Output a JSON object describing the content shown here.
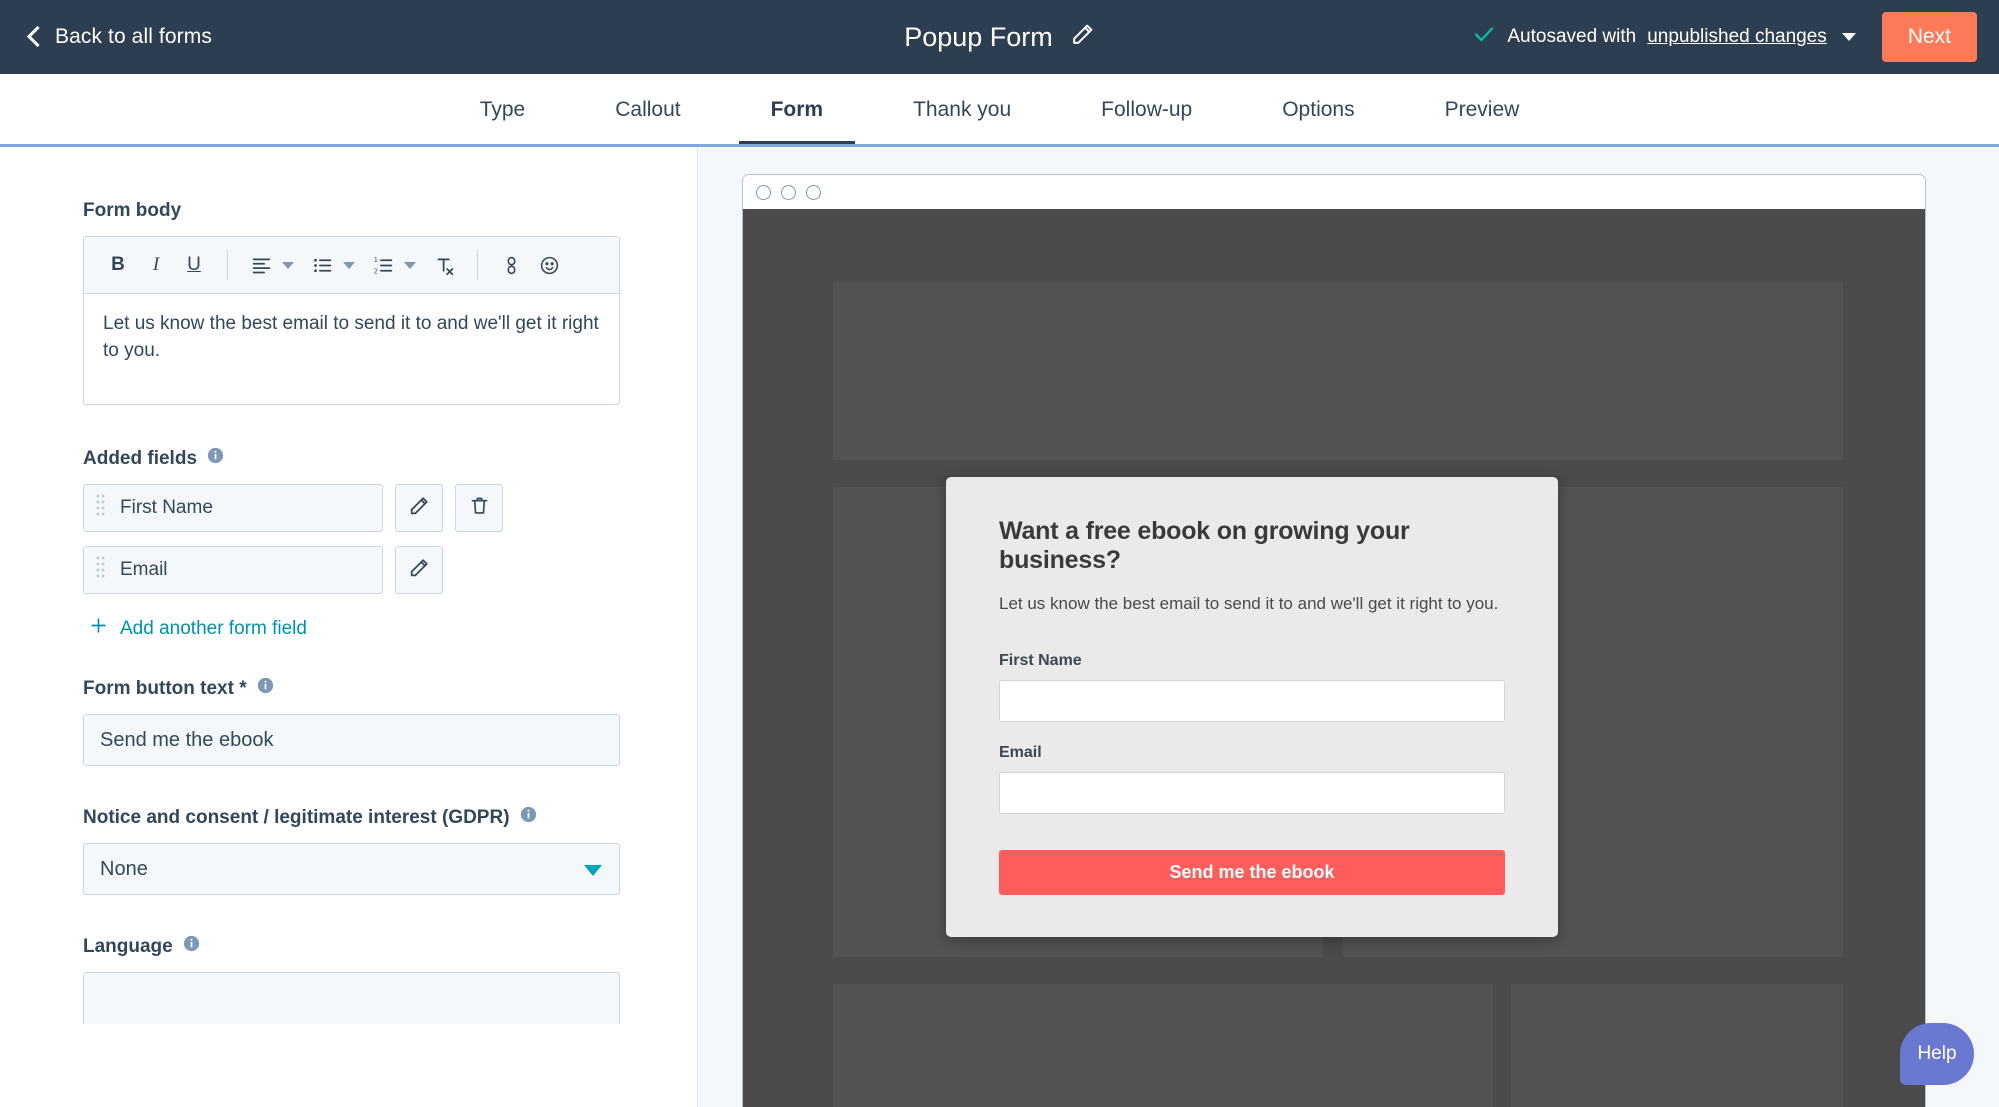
{
  "topbar": {
    "back_label": "Back to all forms",
    "form_title": "Popup Form",
    "edit_icon": "pencil-icon",
    "check_icon": "check-icon",
    "autosave_prefix": "Autosaved with ",
    "autosave_link": "unpublished changes",
    "next_label": "Next",
    "accent_orange": "#ff7a59",
    "header_bg": "#2d3e50"
  },
  "tabs": [
    {
      "label": "Type",
      "active": false
    },
    {
      "label": "Callout",
      "active": false
    },
    {
      "label": "Form",
      "active": true
    },
    {
      "label": "Thank you",
      "active": false
    },
    {
      "label": "Follow-up",
      "active": false
    },
    {
      "label": "Options",
      "active": false
    },
    {
      "label": "Preview",
      "active": false
    }
  ],
  "editor": {
    "form_body_label": "Form body",
    "toolbar": [
      {
        "name": "bold-icon",
        "glyph": "B"
      },
      {
        "name": "italic-icon",
        "glyph": "I"
      },
      {
        "name": "underline-icon",
        "glyph": "U"
      }
    ],
    "body_text": "Let us know the best email to send it to and we'll get it right to you.",
    "added_fields_label": "Added fields",
    "fields": [
      {
        "label": "First Name",
        "deletable": true
      },
      {
        "label": "Email",
        "deletable": false
      }
    ],
    "add_field_label": "Add another form field",
    "button_text_label": "Form button text *",
    "button_text_value": "Send me the ebook",
    "gdpr_label": "Notice and consent / legitimate interest (GDPR)",
    "gdpr_value": "None",
    "language_label": "Language"
  },
  "preview": {
    "popup_title": "Want a free ebook on growing your business?",
    "popup_subtitle": "Let us know the best email to send it to and we'll get it right to you.",
    "fields": [
      {
        "label": "First Name",
        "value": ""
      },
      {
        "label": "Email",
        "value": ""
      }
    ],
    "submit_label": "Send me the ebook",
    "submit_color": "#ff5c5c",
    "popup_bg": "#eaeaea"
  },
  "help": {
    "label": "Help",
    "color": "#6a78d1"
  }
}
